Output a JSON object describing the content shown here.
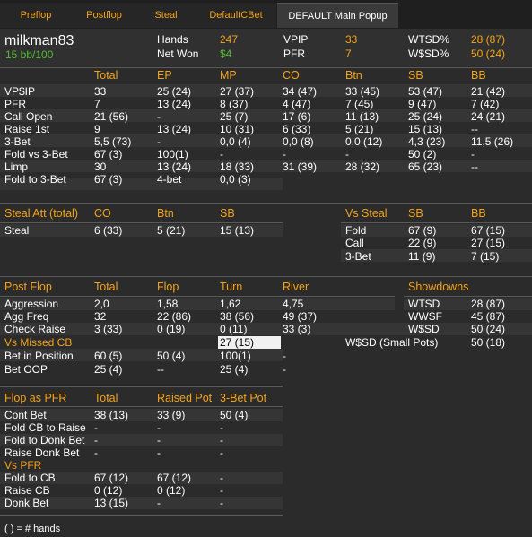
{
  "tabs": [
    "Preflop",
    "Postflop",
    "Steal",
    "DefaultCBet",
    "DEFAULT Main Popup"
  ],
  "player": {
    "name": "milkman83",
    "stack": "15 bb/100"
  },
  "summary": {
    "hands_label": "Hands",
    "hands": "247",
    "netwon_label": "Net Won",
    "netwon": "$4",
    "vpip_label": "VPIP",
    "vpip": "33",
    "pfr_label": "PFR",
    "pfr": "7",
    "wtsd_label": "WTSD%",
    "wtsd": "28 (87)",
    "wsd_label": "W$SD%",
    "wsd": "50 (24)"
  },
  "positions": {
    "headers": [
      "Total",
      "EP",
      "MP",
      "CO",
      "Btn",
      "SB",
      "BB"
    ],
    "rows": [
      {
        "label": "VP$IP",
        "cells": [
          "33",
          "25 (24)",
          "27 (37)",
          "34 (47)",
          "33 (45)",
          "53 (47)",
          "21 (42)"
        ]
      },
      {
        "label": "PFR",
        "cells": [
          "7",
          "13 (24)",
          "8 (37)",
          "4 (47)",
          "7 (45)",
          "9 (47)",
          "7 (42)"
        ]
      },
      {
        "label": "Call Open",
        "cells": [
          "21 (56)",
          "-",
          "25 (7)",
          "17 (6)",
          "11 (13)",
          "25 (24)",
          "24 (21)"
        ]
      },
      {
        "label": "Raise 1st",
        "cells": [
          "9",
          "13 (24)",
          "10 (31)",
          "6 (33)",
          "5 (21)",
          "15 (13)",
          "--"
        ]
      },
      {
        "label": "3-Bet",
        "cells": [
          "5,5 (73)",
          "-",
          "0,0 (4)",
          "0,0 (8)",
          "0,0 (12)",
          "4,3 (23)",
          "11,5 (26)"
        ]
      },
      {
        "label": "Fold vs 3-Bet",
        "cells": [
          "67 (3)",
          "100(1)",
          "-",
          "-",
          "-",
          "50 (2)",
          "-"
        ]
      },
      {
        "label": "Limp",
        "cells": [
          "30",
          "13 (24)",
          "18 (33)",
          "31 (39)",
          "28 (32)",
          "65 (23)",
          "--"
        ]
      },
      {
        "label": "Fold to 3-Bet",
        "cells": [
          "67 (3)",
          "4-bet",
          "0,0 (3)",
          "",
          "",
          "",
          ""
        ]
      }
    ]
  },
  "steal": {
    "title": "Steal Att (total)",
    "headers": [
      "CO",
      "Btn",
      "SB"
    ],
    "row_label": "Steal",
    "cells": [
      "6 (33)",
      "5 (21)",
      "15 (13)"
    ],
    "vs_title": "Vs Steal",
    "vs_headers": [
      "SB",
      "BB"
    ],
    "vs_rows": [
      {
        "label": "Fold",
        "cells": [
          "67 (9)",
          "67 (15)"
        ]
      },
      {
        "label": "Call",
        "cells": [
          "22 (9)",
          "27 (15)"
        ]
      },
      {
        "label": "3-Bet",
        "cells": [
          "11 (9)",
          "7 (15)"
        ]
      }
    ]
  },
  "postflop": {
    "title": "Post Flop",
    "headers": [
      "Total",
      "Flop",
      "Turn",
      "River"
    ],
    "rows": [
      {
        "label": "Aggression",
        "cells": [
          "2,0",
          "1,58",
          "1,62",
          "4,75"
        ]
      },
      {
        "label": "Agg Freq",
        "cells": [
          "32",
          "22 (86)",
          "38 (56)",
          "49 (37)"
        ]
      },
      {
        "label": "Check Raise",
        "cells": [
          "3 (33)",
          "0 (19)",
          "0 (11)",
          "33 (3)"
        ]
      }
    ],
    "vs_missed_title": "Vs Missed CB",
    "vs_missed_highlight": "27 (15)",
    "rows2": [
      {
        "label": "Bet in Position",
        "cells": [
          "60 (5)",
          "50 (4)",
          "100(1)",
          "-"
        ]
      },
      {
        "label": "Bet OOP",
        "cells": [
          "25 (4)",
          "--",
          "25 (4)",
          "-"
        ]
      }
    ],
    "showdowns_title": "Showdowns",
    "showdowns": [
      {
        "label": "WTSD",
        "value": "28 (87)"
      },
      {
        "label": "WWSF",
        "value": "45 (87)"
      },
      {
        "label": "W$SD",
        "value": "50 (24)"
      },
      {
        "label": "W$SD (Small Pots)",
        "value": "50 (18)"
      }
    ]
  },
  "flop_pfr": {
    "title": "Flop as PFR",
    "headers": [
      "Total",
      "Raised Pot",
      "3-Bet Pot"
    ],
    "rows": [
      {
        "label": "Cont Bet",
        "cells": [
          "38 (13)",
          "33 (9)",
          "50 (4)"
        ]
      },
      {
        "label": "Fold CB to Raise",
        "cells": [
          "-",
          "-",
          "-"
        ]
      },
      {
        "label": "Fold to Donk Bet",
        "cells": [
          "-",
          "-",
          "-"
        ]
      },
      {
        "label": "Raise Donk Bet",
        "cells": [
          "-",
          "-",
          "-"
        ]
      }
    ],
    "vs_pfr_title": "Vs PFR",
    "rows2": [
      {
        "label": "Fold to CB",
        "cells": [
          "67 (12)",
          "67 (12)",
          "-"
        ]
      },
      {
        "label": "Raise CB",
        "cells": [
          "0 (12)",
          "0 (12)",
          "-"
        ]
      },
      {
        "label": "Donk Bet",
        "cells": [
          "13 (15)",
          "-",
          "-"
        ]
      }
    ]
  },
  "footer": "( ) = # hands"
}
